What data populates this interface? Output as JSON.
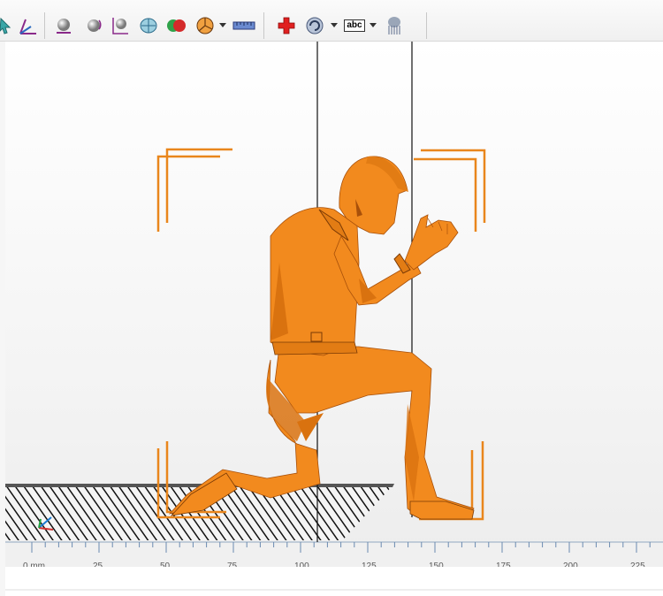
{
  "toolbar": {
    "buttons": [
      {
        "name": "select-arrow-icon"
      },
      {
        "name": "axis-icon"
      },
      {
        "name": "view-sphere-icon"
      },
      {
        "name": "rotate-object-icon"
      },
      {
        "name": "scale-object-icon"
      },
      {
        "name": "view-wireframe-icon"
      },
      {
        "name": "color-spheres-icon"
      },
      {
        "name": "pie-section-icon"
      },
      {
        "name": "ruler-measure-icon"
      },
      {
        "name": "add-red-cross-icon"
      },
      {
        "name": "rotate-view-icon"
      },
      {
        "name": "text-label-icon",
        "label": "abc"
      },
      {
        "name": "support-structures-icon"
      }
    ]
  },
  "ruler": {
    "unit_label": "0 mm",
    "ticks": [
      "25",
      "50",
      "75",
      "100",
      "125",
      "150",
      "175",
      "200",
      "225"
    ]
  },
  "colors": {
    "model": "#f28a1e",
    "model_dark": "#c9650a",
    "bracket": "#e9861c",
    "grid": "#1a1a1a"
  }
}
